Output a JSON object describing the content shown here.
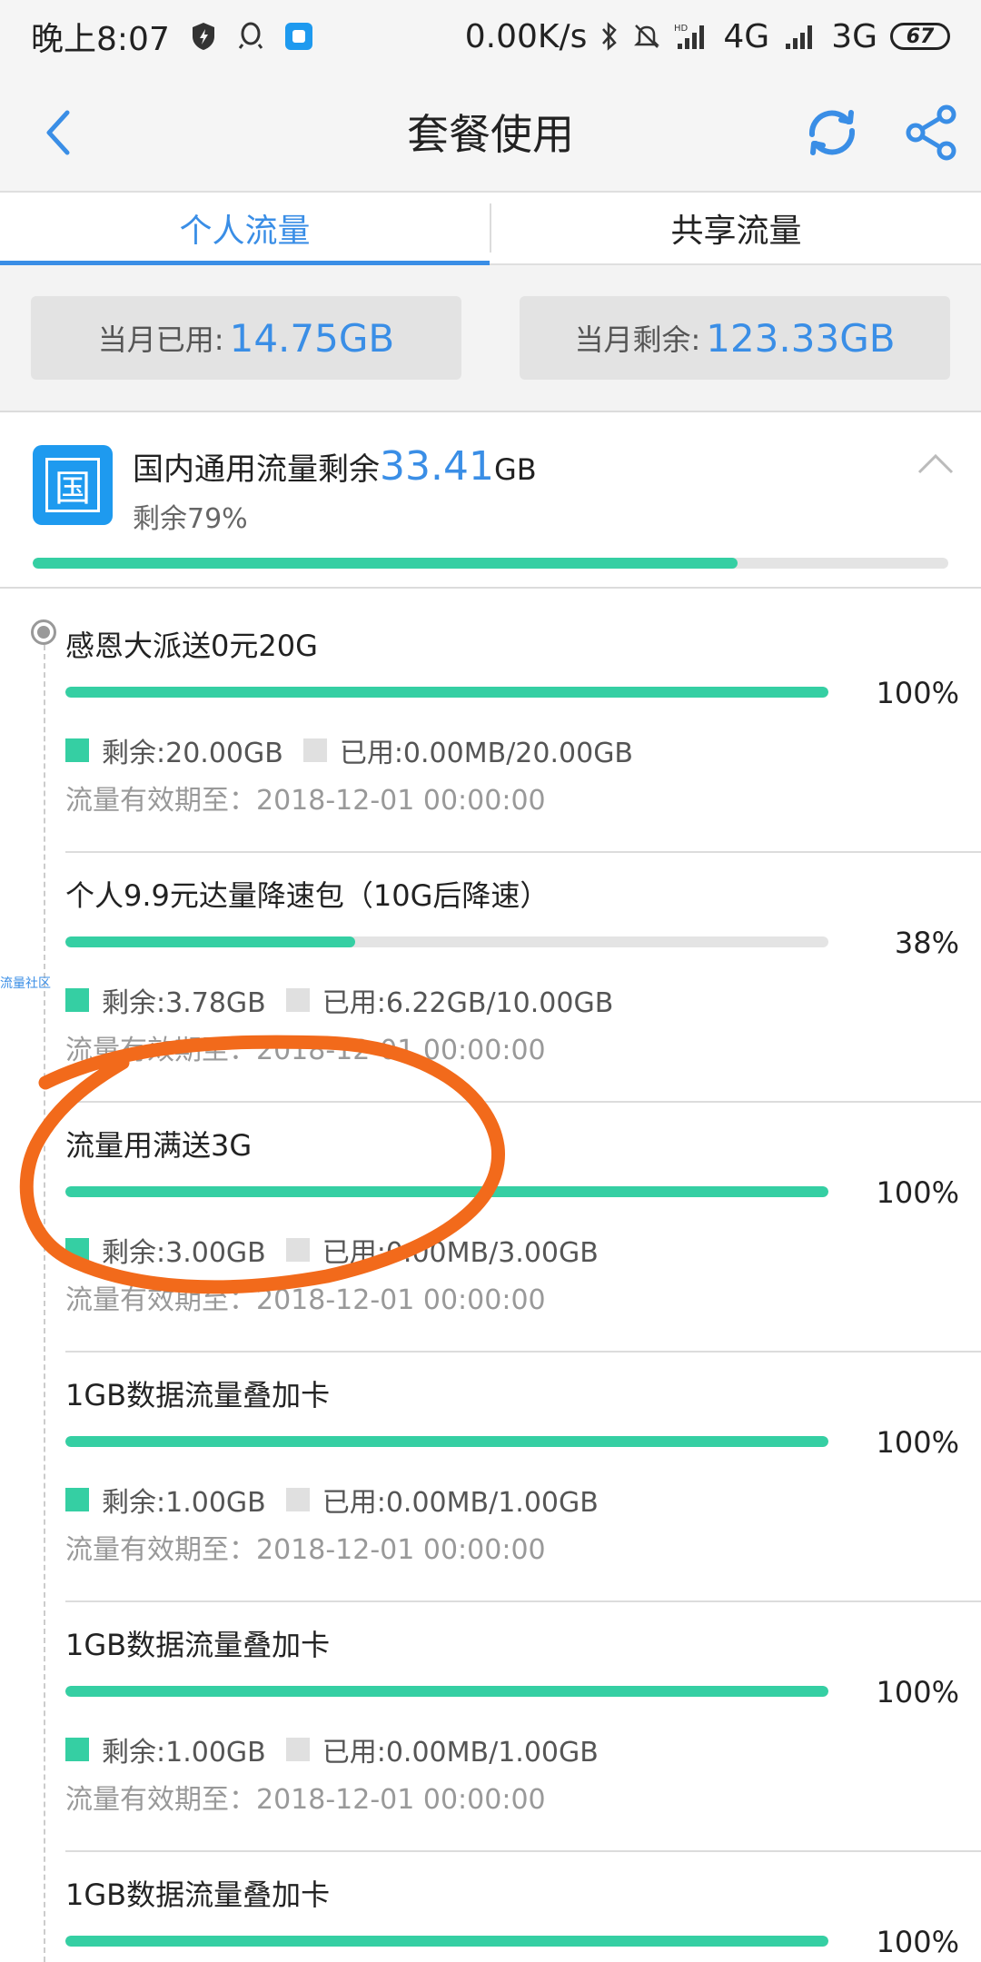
{
  "status_bar": {
    "time": "晚上8:07",
    "network_speed": "0.00K/s",
    "signal_1": "4G",
    "signal_2": "3G",
    "battery": "67",
    "icons": [
      "shield-icon",
      "qq-icon",
      "app-icon",
      "bluetooth-icon",
      "mute-bell-icon",
      "hd-signal-icon",
      "signal-icon"
    ]
  },
  "header": {
    "title": "套餐使用",
    "icons": [
      "back-icon",
      "refresh-icon",
      "share-icon"
    ],
    "accent_color": "#3a8ee6"
  },
  "tabs": [
    {
      "label": "个人流量",
      "active": true
    },
    {
      "label": "共享流量",
      "active": false
    }
  ],
  "summary": {
    "used_label": "当月已用:",
    "used_value": "14.75GB",
    "remaining_label": "当月剩余:",
    "remaining_value": "123.33GB"
  },
  "domestic": {
    "icon_text": "国",
    "title": "国内通用流量剩余",
    "amount": "33.41",
    "unit": "GB",
    "remaining_percent_text": "剩余79%",
    "remaining_fraction": 0.77,
    "bar_color": "#35cfa3"
  },
  "side_mark": "流量社区",
  "packages": [
    {
      "name": "感恩大派送0元20G",
      "percent": "100%",
      "fraction": 1.0,
      "remaining": "剩余:20.00GB",
      "used": "已用:0.00MB/20.00GB",
      "expiry": "流量有效期至：2018-12-01 00:00:00"
    },
    {
      "name": "个人9.9元达量降速包（10G后降速）",
      "percent": "38%",
      "fraction": 0.38,
      "remaining": "剩余:3.78GB",
      "used": "已用:6.22GB/10.00GB",
      "expiry": "流量有效期至：2018-12-01 00:00:00"
    },
    {
      "name": "流量用满送3G",
      "percent": "100%",
      "fraction": 1.0,
      "remaining": "剩余:3.00GB",
      "used": "已用:0.00MB/3.00GB",
      "expiry": "流量有效期至：2018-12-01 00:00:00"
    },
    {
      "name": "1GB数据流量叠加卡",
      "percent": "100%",
      "fraction": 1.0,
      "remaining": "剩余:1.00GB",
      "used": "已用:0.00MB/1.00GB",
      "expiry": "流量有效期至：2018-12-01 00:00:00"
    },
    {
      "name": "1GB数据流量叠加卡",
      "percent": "100%",
      "fraction": 1.0,
      "remaining": "剩余:1.00GB",
      "used": "已用:0.00MB/1.00GB",
      "expiry": "流量有效期至：2018-12-01 00:00:00"
    },
    {
      "name": "1GB数据流量叠加卡",
      "percent": "100%",
      "fraction": 1.0,
      "remaining": "",
      "used": "",
      "expiry": ""
    }
  ],
  "annotation_color": "#f26a1b"
}
